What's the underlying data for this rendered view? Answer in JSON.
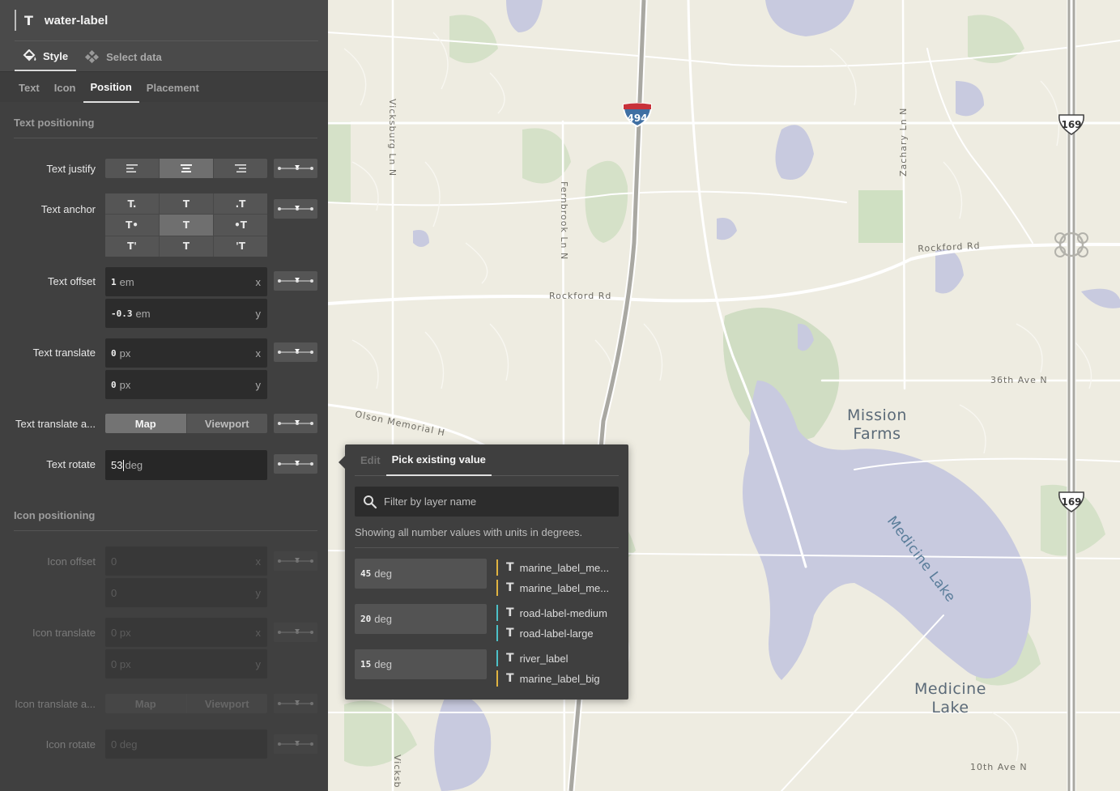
{
  "layer": {
    "icon": "text-layer-icon",
    "name": "water-label"
  },
  "main_tabs": [
    {
      "label": "Style",
      "icon": "paint-bucket-icon",
      "active": true
    },
    {
      "label": "Select data",
      "icon": "data-nodes-icon",
      "active": false
    }
  ],
  "sub_tabs": [
    {
      "label": "Text",
      "active": false
    },
    {
      "label": "Icon",
      "active": false
    },
    {
      "label": "Position",
      "active": true
    },
    {
      "label": "Placement",
      "active": false
    }
  ],
  "text_positioning": {
    "section_title": "Text positioning",
    "justify": {
      "label": "Text justify",
      "options": [
        "left",
        "center",
        "right"
      ],
      "selected": "center"
    },
    "anchor": {
      "label": "Text anchor",
      "glyphs": [
        "T.",
        "T",
        ".T",
        "T•",
        "T",
        "•T",
        "T'",
        "T",
        "'T"
      ],
      "selected": "center"
    },
    "offset": {
      "label": "Text offset",
      "x": {
        "value": "1",
        "unit": "em",
        "axis": "x"
      },
      "y": {
        "value": "-0.3",
        "unit": "em",
        "axis": "y"
      }
    },
    "translate": {
      "label": "Text translate",
      "x": {
        "value": "0",
        "unit": "px",
        "axis": "x"
      },
      "y": {
        "value": "0",
        "unit": "px",
        "axis": "y"
      }
    },
    "translate_anchor": {
      "label": "Text translate a...",
      "options": [
        "Map",
        "Viewport"
      ],
      "selected": "Map"
    },
    "rotate": {
      "label": "Text rotate",
      "value": "53",
      "unit": "deg"
    }
  },
  "icon_positioning": {
    "section_title": "Icon positioning",
    "offset": {
      "label": "Icon offset",
      "x": {
        "value": "0",
        "axis": "x"
      },
      "y": {
        "value": "0",
        "axis": "y"
      }
    },
    "translate": {
      "label": "Icon translate",
      "x": {
        "value": "0 px",
        "axis": "x"
      },
      "y": {
        "value": "0 px",
        "axis": "y"
      }
    },
    "translate_anchor": {
      "label": "Icon translate a...",
      "options": [
        "Map",
        "Viewport"
      ]
    },
    "rotate": {
      "label": "Icon rotate",
      "value": "0 deg"
    }
  },
  "popover": {
    "tabs": [
      {
        "label": "Edit",
        "active": false
      },
      {
        "label": "Pick existing value",
        "active": true
      }
    ],
    "search_placeholder": "Filter by layer name",
    "search_icon": "search-icon",
    "hint": "Showing all number values with units in degrees.",
    "values": [
      {
        "value": "45",
        "unit": "deg",
        "layers": [
          {
            "name": "marine_label_me...",
            "color": "#e0b341"
          },
          {
            "name": "marine_label_me...",
            "color": "#e0b341"
          }
        ]
      },
      {
        "value": "20",
        "unit": "deg",
        "layers": [
          {
            "name": "road-label-medium",
            "color": "#4cc1c8"
          },
          {
            "name": "road-label-large",
            "color": "#4cc1c8"
          }
        ]
      },
      {
        "value": "15",
        "unit": "deg",
        "layers": [
          {
            "name": "river_label",
            "color": "#4cc1c8"
          },
          {
            "name": "marine_label_big",
            "color": "#e0b341"
          }
        ]
      }
    ]
  },
  "map": {
    "colors": {
      "land": "#eeece1",
      "water": "#c8cadf",
      "park": "#d3e0c6",
      "road": "#ffffff",
      "highway": "#a9a8a2"
    },
    "road_labels": [
      "Vicksburg Ln N",
      "Fernbrook Ln N",
      "Zachary Ln N",
      "Rockford Rd",
      "Rockford Rd",
      "36th Ave N",
      "Olson Memorial H",
      "10th Ave N",
      "Vicksb"
    ],
    "place_labels": [
      "Mission\nFarms",
      "Medicine\nLake"
    ],
    "water_labels": [
      "Medicine Lake"
    ],
    "shields": [
      "494",
      "169",
      "169"
    ]
  }
}
